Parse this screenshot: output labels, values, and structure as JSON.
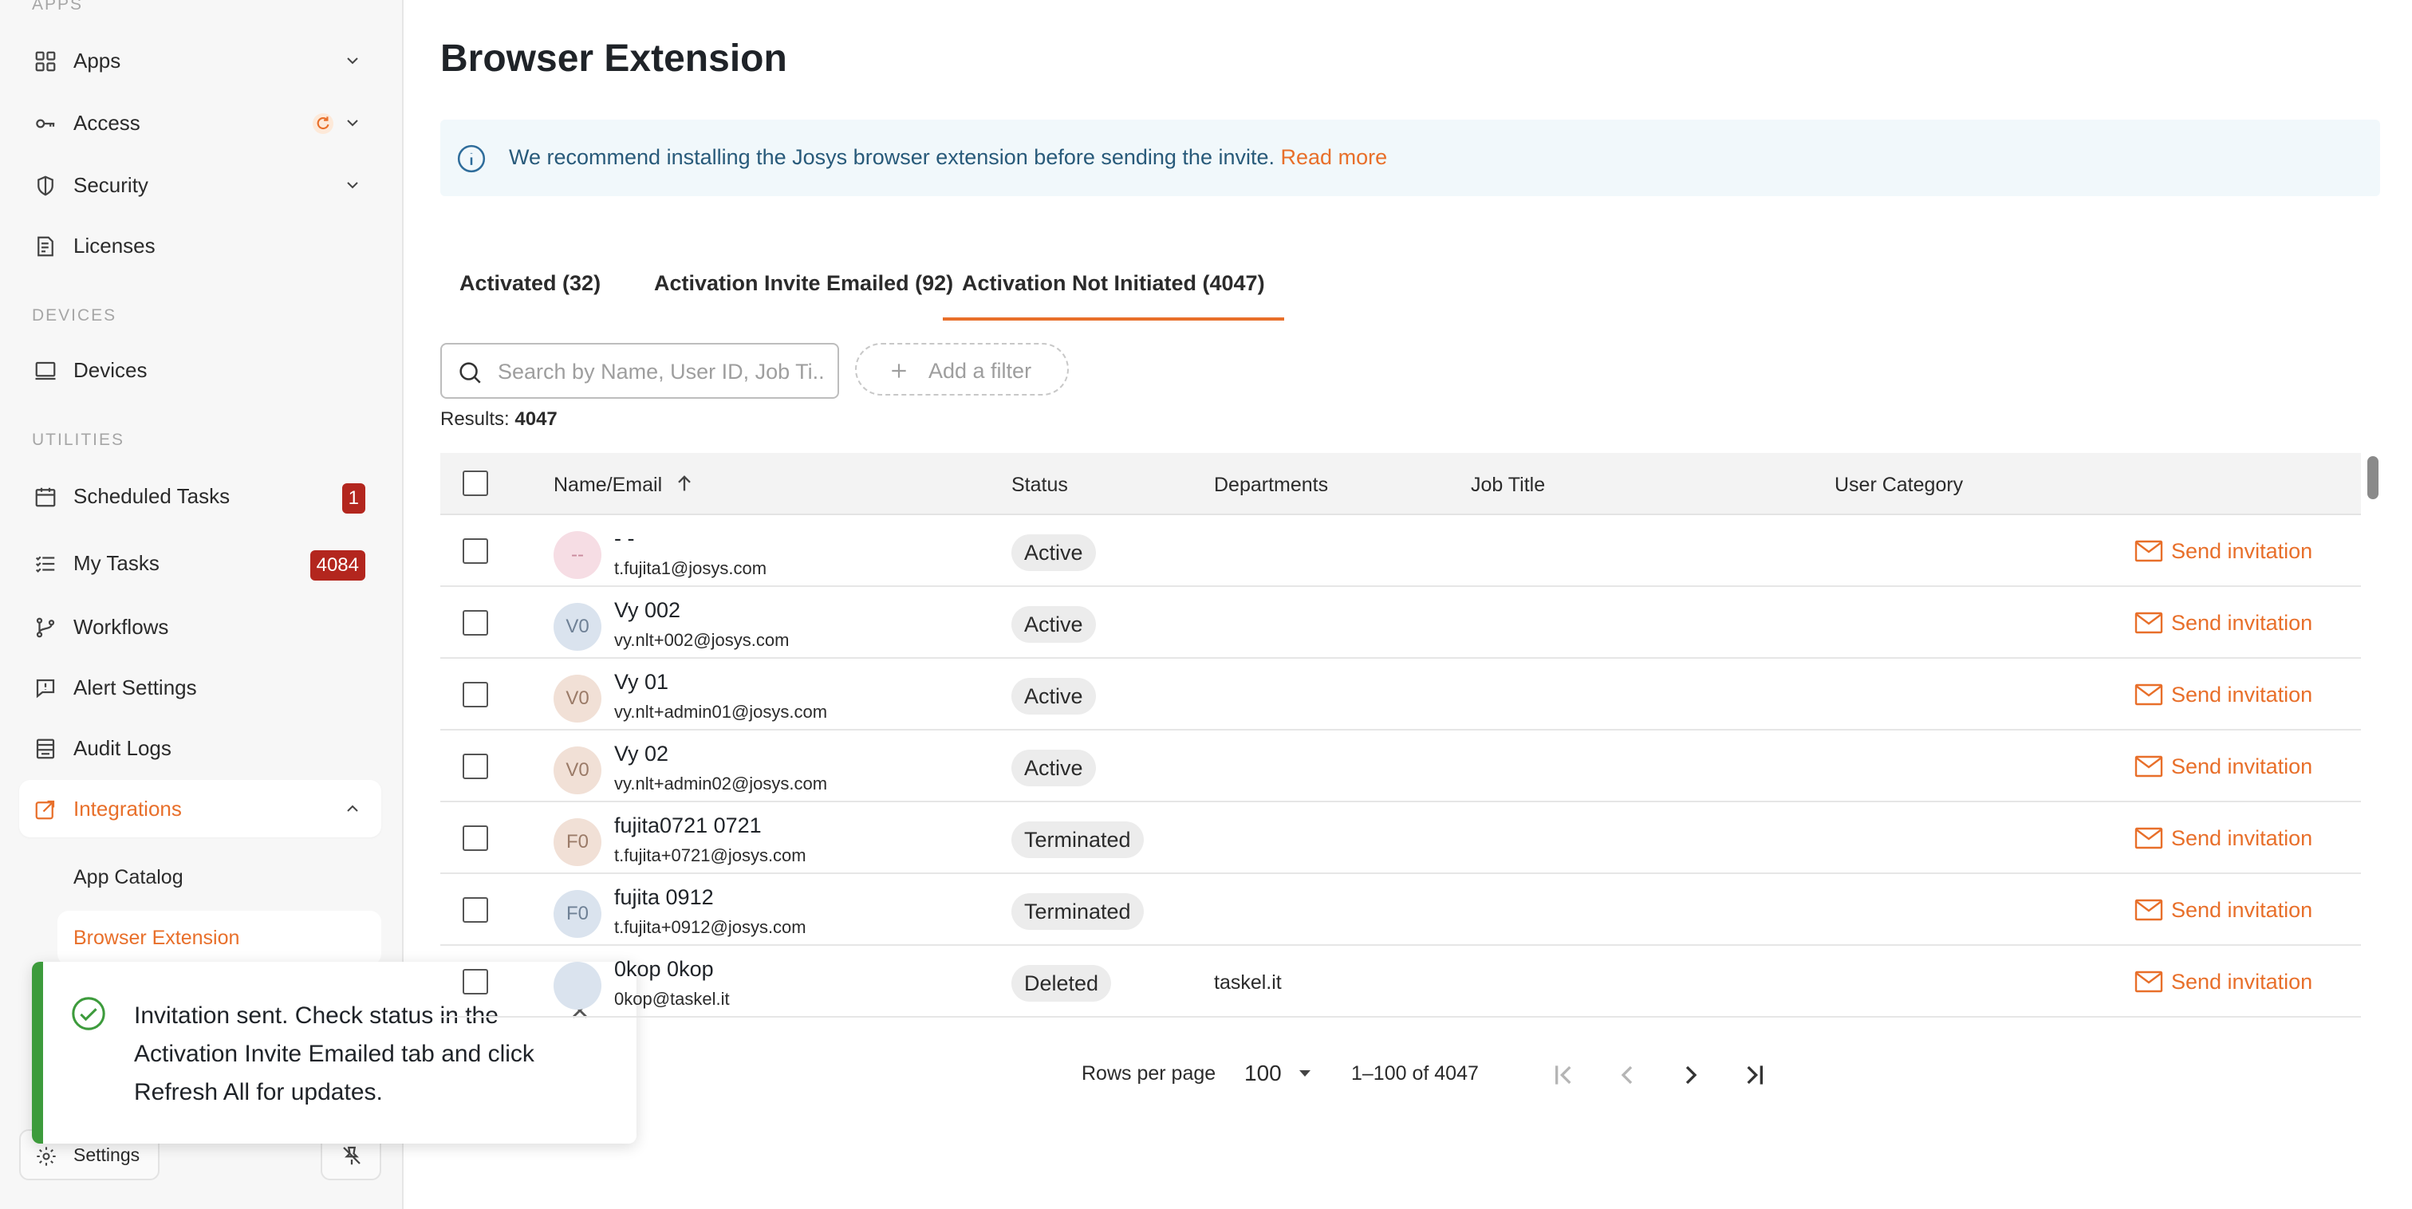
{
  "sidebar": {
    "apps_label": "APPS",
    "devices_label": "DEVICES",
    "utilities_label": "UTILITIES",
    "items": {
      "apps": "Apps",
      "access": "Access",
      "security": "Security",
      "licenses": "Licenses",
      "devices": "Devices",
      "scheduled_tasks": "Scheduled Tasks",
      "scheduled_tasks_badge": "1",
      "my_tasks": "My Tasks",
      "my_tasks_badge": "4084",
      "workflows": "Workflows",
      "alert_settings": "Alert Settings",
      "audit_logs": "Audit Logs",
      "integrations": "Integrations",
      "app_catalog": "App Catalog",
      "browser_extension": "Browser Extension"
    },
    "settings_label": "Settings"
  },
  "toast": {
    "message": "Invitation sent. Check status in the Activation Invite Emailed tab and click Refresh All for updates."
  },
  "main": {
    "title": "Browser Extension",
    "info_text": "We recommend installing the Josys browser extension before sending the invite.",
    "info_link": "Read more",
    "tabs": [
      "Activated (32)",
      "Activation Invite Emailed (92)",
      "Activation Not Initiated (4047)"
    ],
    "search_placeholder": "Search by Name, User ID, Job Ti...",
    "add_filter": "Add a filter",
    "results_label": "Results:",
    "results_count": "4047",
    "columns": [
      "Name/Email",
      "Status",
      "Departments",
      "Job Title",
      "User Category"
    ],
    "action_label": "Send invitation",
    "rows": [
      {
        "initials": "--",
        "avatar_bg": "#f6dde4",
        "avatar_fg": "#c98a9c",
        "name": "- -",
        "email": "t.fujita1@josys.com",
        "status": "Active",
        "department": ""
      },
      {
        "initials": "V0",
        "avatar_bg": "#dae3ee",
        "avatar_fg": "#6f8196",
        "name": "Vy 002",
        "email": "vy.nlt+002@josys.com",
        "status": "Active",
        "department": ""
      },
      {
        "initials": "V0",
        "avatar_bg": "#f1e0d6",
        "avatar_fg": "#9b7b68",
        "name": "Vy 01",
        "email": "vy.nlt+admin01@josys.com",
        "status": "Active",
        "department": ""
      },
      {
        "initials": "V0",
        "avatar_bg": "#f1e0d6",
        "avatar_fg": "#9b7b68",
        "name": "Vy 02",
        "email": "vy.nlt+admin02@josys.com",
        "status": "Active",
        "department": ""
      },
      {
        "initials": "F0",
        "avatar_bg": "#f1e0d6",
        "avatar_fg": "#9b7b68",
        "name": "fujita0721 0721",
        "email": "t.fujita+0721@josys.com",
        "status": "Terminated",
        "department": ""
      },
      {
        "initials": "F0",
        "avatar_bg": "#dae3ee",
        "avatar_fg": "#6f8196",
        "name": "fujita 0912",
        "email": "t.fujita+0912@josys.com",
        "status": "Terminated",
        "department": ""
      },
      {
        "initials": "",
        "avatar_bg": "#dae3ee",
        "avatar_fg": "#6f8196",
        "name": "0kop 0kop",
        "email": "0kop@taskel.it",
        "status": "Deleted",
        "department": "taskel.it"
      }
    ],
    "pagination": {
      "rows_per_page_label": "Rows per page",
      "rows_per_page": "100",
      "range": "1–100 of 4047"
    },
    "accent_color": "#e86f2a"
  }
}
